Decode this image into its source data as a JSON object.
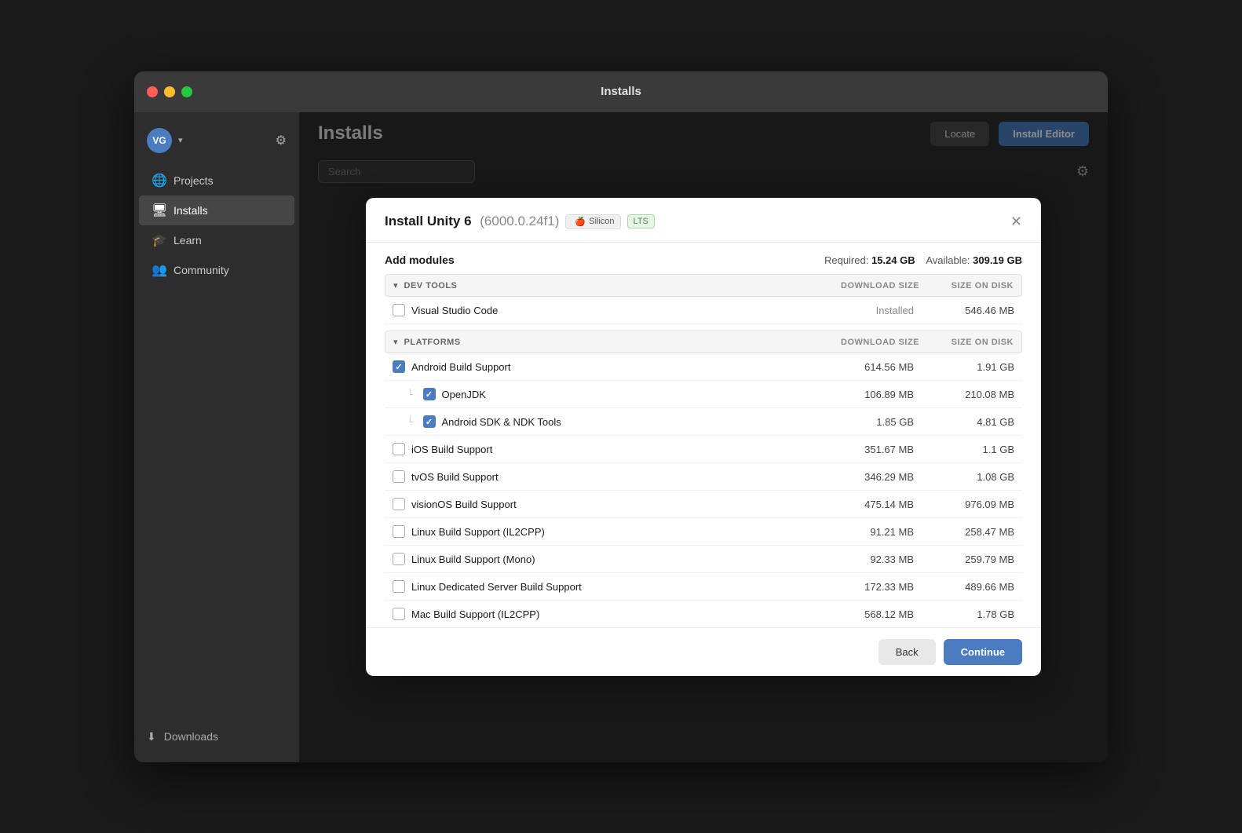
{
  "window": {
    "title": "Installs"
  },
  "sidebar": {
    "avatar_initials": "VG",
    "items": [
      {
        "id": "projects",
        "label": "Projects",
        "icon": "🌐"
      },
      {
        "id": "installs",
        "label": "Installs",
        "icon": "🖥",
        "active": true
      },
      {
        "id": "learn",
        "label": "Learn",
        "icon": "🎓"
      },
      {
        "id": "community",
        "label": "Community",
        "icon": "👥"
      }
    ],
    "downloads_label": "Downloads"
  },
  "header": {
    "title": "Installs",
    "locate_label": "Locate",
    "install_editor_label": "Install Editor",
    "search_placeholder": "Search"
  },
  "modal": {
    "title": "Install Unity 6",
    "version": "(6000.0.24f1)",
    "badge_silicon": "Silicon",
    "badge_lts": "LTS",
    "add_modules_label": "Add modules",
    "required_label": "Required:",
    "required_value": "15.24 GB",
    "available_label": "Available:",
    "available_value": "309.19 GB",
    "sections": [
      {
        "id": "dev-tools",
        "name": "DEV TOOLS",
        "col_download": "DOWNLOAD SIZE",
        "col_disk": "SIZE ON DISK",
        "items": [
          {
            "name": "Visual Studio Code",
            "checked": false,
            "installed": true,
            "installed_label": "Installed",
            "download_size": "",
            "disk_size": "546.46 MB",
            "indent": 0
          }
        ]
      },
      {
        "id": "platforms",
        "name": "PLATFORMS",
        "col_download": "DOWNLOAD SIZE",
        "col_disk": "SIZE ON DISK",
        "items": [
          {
            "name": "Android Build Support",
            "checked": true,
            "installed": false,
            "download_size": "614.56 MB",
            "disk_size": "1.91 GB",
            "indent": 0
          },
          {
            "name": "OpenJDK",
            "checked": true,
            "installed": false,
            "download_size": "106.89 MB",
            "disk_size": "210.08 MB",
            "indent": 1
          },
          {
            "name": "Android SDK & NDK Tools",
            "checked": true,
            "installed": false,
            "download_size": "1.85 GB",
            "disk_size": "4.81 GB",
            "indent": 1
          },
          {
            "name": "iOS Build Support",
            "checked": false,
            "installed": false,
            "download_size": "351.67 MB",
            "disk_size": "1.1 GB",
            "indent": 0
          },
          {
            "name": "tvOS Build Support",
            "checked": false,
            "installed": false,
            "download_size": "346.29 MB",
            "disk_size": "1.08 GB",
            "indent": 0
          },
          {
            "name": "visionOS Build Support",
            "checked": false,
            "installed": false,
            "download_size": "475.14 MB",
            "disk_size": "976.09 MB",
            "indent": 0
          },
          {
            "name": "Linux Build Support (IL2CPP)",
            "checked": false,
            "installed": false,
            "download_size": "91.21 MB",
            "disk_size": "258.47 MB",
            "indent": 0
          },
          {
            "name": "Linux Build Support (Mono)",
            "checked": false,
            "installed": false,
            "download_size": "92.33 MB",
            "disk_size": "259.79 MB",
            "indent": 0
          },
          {
            "name": "Linux Dedicated Server Build Support",
            "checked": false,
            "installed": false,
            "download_size": "172.33 MB",
            "disk_size": "489.66 MB",
            "indent": 0
          },
          {
            "name": "Mac Build Support (IL2CPP)",
            "checked": false,
            "installed": false,
            "download_size": "568.12 MB",
            "disk_size": "1.78 GB",
            "indent": 0
          }
        ]
      }
    ],
    "back_label": "Back",
    "continue_label": "Continue"
  }
}
